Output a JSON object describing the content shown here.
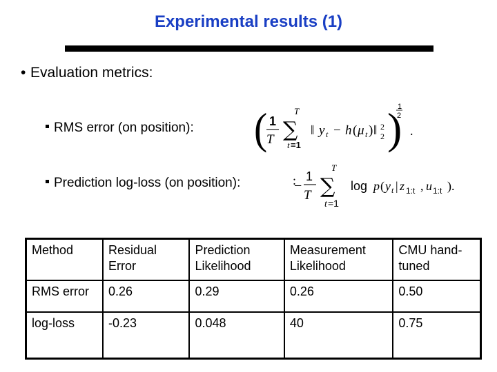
{
  "slide": {
    "title": "Experimental results (1)",
    "title_color": "#1a3fc4",
    "bullet": "Evaluation metrics:",
    "bullet_icon": "round-bullet-icon",
    "sub_bullet_icon": "square-bullet-icon",
    "sub_bullets": [
      {
        "label": "RMS error (on position):",
        "formula_text": "(1/T Σ_{t=1}^{T} ||y_t − h(μ_t)||_2^2)^{1/2}."
      },
      {
        "label": "Prediction log-loss (on position):",
        "formula_text": "−1/T Σ_{t=1}^{T} log p(y_t | z_{1:t}, u_{1:t})."
      }
    ],
    "formula1": {
      "one": "1",
      "T": "T",
      "sum": "∑",
      "sum_top": "T",
      "sum_bottom_var": "t",
      "sum_bottom_eq": "=1",
      "norm_left": "‖",
      "y": "y",
      "t": "t",
      "minus": "−",
      "h": "h",
      "paren_open": "(",
      "mu": "μ",
      "paren_close": ")",
      "norm_right": "‖",
      "sup2": "2",
      "sub2": "2",
      "big_open": "(",
      "big_close": ")",
      "half_num": "1",
      "half_den": "2",
      "period": "."
    },
    "formula2": {
      "minus": "−",
      "one": "1",
      "T": "T",
      "sum": "∑",
      "sum_top": "T",
      "sum_bottom_var": "t",
      "sum_bottom_eq": "=1",
      "log": "log",
      "p": "p",
      "open": "(",
      "y": "y",
      "t": "t",
      "bar": "|",
      "z": "z",
      "range": "1:t",
      "comma": ",",
      "u": "u",
      "close": ").",
      "lead_colon": ":"
    }
  },
  "table": {
    "headers": [
      [
        "Method",
        ""
      ],
      [
        "Residual",
        "Error"
      ],
      [
        "Prediction",
        "Likelihood"
      ],
      [
        "Measurement",
        "Likelihood"
      ],
      [
        "CMU hand-",
        "tuned"
      ]
    ],
    "rows": [
      [
        "RMS error",
        "0.26",
        "0.29",
        "0.26",
        "0.50"
      ],
      [
        "log-loss",
        "-0.23",
        "0.048",
        "40",
        "0.75"
      ]
    ]
  }
}
